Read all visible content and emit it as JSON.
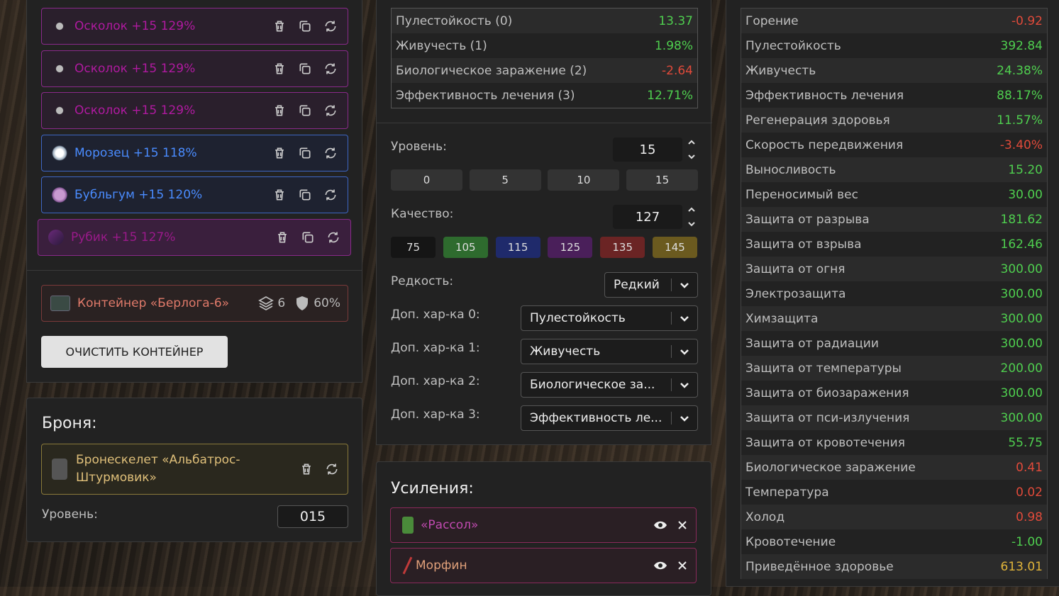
{
  "artifacts": [
    {
      "name": "Осколок +15 129%",
      "color": "#b01aa0",
      "icon": "shard-icon",
      "variant": "purple"
    },
    {
      "name": "Осколок +15 129%",
      "color": "#b01aa0",
      "icon": "shard-icon",
      "variant": "purple"
    },
    {
      "name": "Осколок +15 129%",
      "color": "#b01aa0",
      "icon": "shard-icon",
      "variant": "purple"
    },
    {
      "name": "Морозец +15 118%",
      "color": "#4a8cff",
      "icon": "frost-orb-icon",
      "variant": "blue"
    },
    {
      "name": "Бубльгум +15 120%",
      "color": "#4a8cff",
      "icon": "bubblegum-icon",
      "variant": "blue"
    },
    {
      "name": "Рубик +15 127%",
      "color": "#9a1a8a",
      "icon": "cube-icon",
      "variant": "selected"
    }
  ],
  "container": {
    "name": "Контейнер «Берлога-6»",
    "slots": "6",
    "protection": "60%"
  },
  "clear_button": "ОЧИСТИТЬ КОНТЕЙНЕР",
  "armor": {
    "title": "Броня:",
    "item_line1": "Бронескелет «Альбатрос-",
    "item_line2": "Штурмовик»",
    "level_label": "Уровень:",
    "level_value": "015"
  },
  "bonus_stats": [
    {
      "label": "Пулестойкость (0)",
      "value": "13.37"
    },
    {
      "label": "Живучесть (1)",
      "value": "1.98%"
    },
    {
      "label": "Биологическое заражение (2)",
      "value": "-2.64"
    },
    {
      "label": "Эффективность лечения (3)",
      "value": "12.71%"
    }
  ],
  "level": {
    "label": "Уровень:",
    "value": "15",
    "presets": [
      "0",
      "5",
      "10",
      "15"
    ]
  },
  "quality": {
    "label": "Качество:",
    "value": "127",
    "presets": [
      {
        "v": "75",
        "bg": "#151515"
      },
      {
        "v": "105",
        "bg": "#2e6b2e"
      },
      {
        "v": "115",
        "bg": "#1f2a6b"
      },
      {
        "v": "125",
        "bg": "#4a1f5a"
      },
      {
        "v": "135",
        "bg": "#6b2424"
      },
      {
        "v": "145",
        "bg": "#6b5a1f"
      }
    ]
  },
  "rarity": {
    "label": "Редкость:",
    "value": "Редкий"
  },
  "extra_stats": [
    {
      "label": "Доп. хар-ка 0:",
      "value": "Пулестойкость"
    },
    {
      "label": "Доп. хар-ка 1:",
      "value": "Живучесть"
    },
    {
      "label": "Доп. хар-ка 2:",
      "value": "Биологическое за..."
    },
    {
      "label": "Доп. хар-ка 3:",
      "value": "Эффективность ле..."
    }
  ],
  "boosts": {
    "title": "Усиления:",
    "items": [
      {
        "name": "«Рассол»",
        "color": "#c04ab0",
        "icon": "jar-icon"
      },
      {
        "name": "Морфин",
        "color": "#e0a07a",
        "icon": "syringe-icon"
      }
    ]
  },
  "summary_stats": [
    {
      "label": "Горение",
      "value": "-0.92",
      "tone": "neg"
    },
    {
      "label": "Пулестойкость",
      "value": "392.84",
      "tone": "pos"
    },
    {
      "label": "Живучесть",
      "value": "24.38%",
      "tone": "pos"
    },
    {
      "label": "Эффективность лечения",
      "value": "88.17%",
      "tone": "pos"
    },
    {
      "label": "Регенерация здоровья",
      "value": "11.57%",
      "tone": "pos"
    },
    {
      "label": "Скорость передвижения",
      "value": "-3.40%",
      "tone": "neg"
    },
    {
      "label": "Выносливость",
      "value": "15.20",
      "tone": "pos"
    },
    {
      "label": "Переносимый вес",
      "value": "30.00",
      "tone": "pos"
    },
    {
      "label": "Защита от разрыва",
      "value": "181.62",
      "tone": "pos"
    },
    {
      "label": "Защита от взрыва",
      "value": "162.46",
      "tone": "pos"
    },
    {
      "label": "Защита от огня",
      "value": "300.00",
      "tone": "pos"
    },
    {
      "label": "Электрозащита",
      "value": "300.00",
      "tone": "pos"
    },
    {
      "label": "Химзащита",
      "value": "300.00",
      "tone": "pos"
    },
    {
      "label": "Защита от радиации",
      "value": "300.00",
      "tone": "pos"
    },
    {
      "label": "Защита от температуры",
      "value": "200.00",
      "tone": "pos"
    },
    {
      "label": "Защита от биозаражения",
      "value": "300.00",
      "tone": "pos"
    },
    {
      "label": "Защита от пси-излучения",
      "value": "300.00",
      "tone": "pos"
    },
    {
      "label": "Защита от кровотечения",
      "value": "55.75",
      "tone": "pos"
    },
    {
      "label": "Биологическое заражение",
      "value": "0.41",
      "tone": "neg"
    },
    {
      "label": "Температура",
      "value": "0.02",
      "tone": "neg"
    },
    {
      "label": "Холод",
      "value": "0.98",
      "tone": "neg"
    },
    {
      "label": "Кровотечение",
      "value": "-1.00",
      "tone": "pos"
    },
    {
      "label": "Приведённое здоровье",
      "value": "613.01",
      "tone": "gold"
    }
  ]
}
